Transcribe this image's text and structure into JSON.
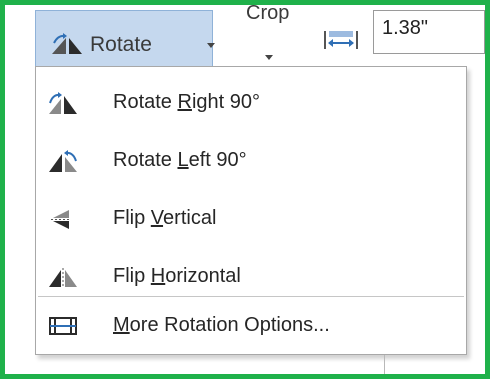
{
  "ribbon": {
    "rotate_label": "Rotate",
    "crop_label": "Crop",
    "width_value": "1.38\""
  },
  "menu": {
    "items": [
      {
        "pre": "Rotate ",
        "key": "R",
        "post": "ight 90°",
        "icon": "rotate-right-icon"
      },
      {
        "pre": "Rotate ",
        "key": "L",
        "post": "eft 90°",
        "icon": "rotate-left-icon"
      },
      {
        "pre": "Flip ",
        "key": "V",
        "post": "ertical",
        "icon": "flip-vertical-icon"
      },
      {
        "pre": "Flip ",
        "key": "H",
        "post": "orizontal",
        "icon": "flip-horizontal-icon"
      },
      {
        "pre": "",
        "key": "M",
        "post": "ore Rotation Options...",
        "icon": "layout-options-icon"
      }
    ]
  },
  "colors": {
    "frame": "#1fb14a",
    "button_highlight": "#c5d8ee",
    "icon_dark": "#555555",
    "icon_blue": "#2f6fb5"
  }
}
